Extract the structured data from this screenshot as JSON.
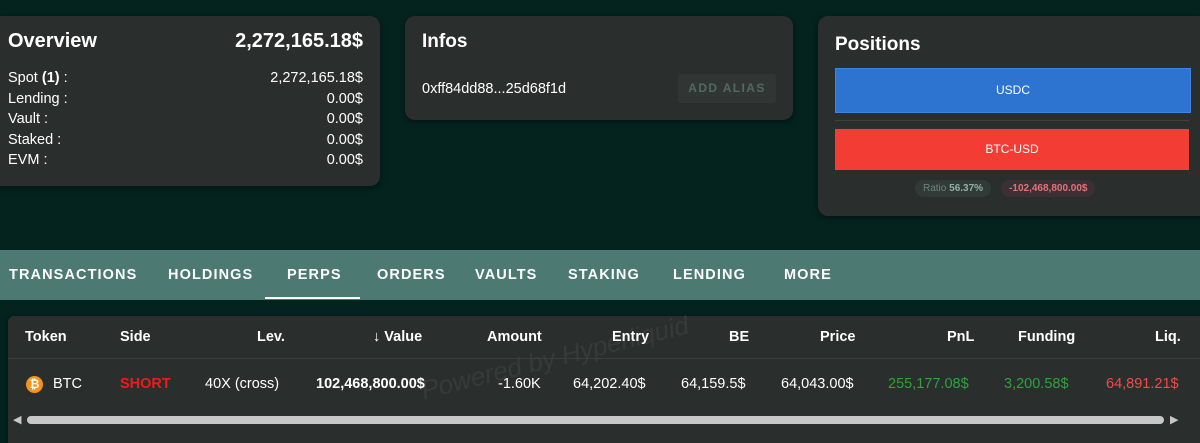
{
  "overview": {
    "title": "Overview",
    "total": "2,272,165.18$",
    "rows": [
      {
        "label": "Spot",
        "badge": "(1)",
        "suffix": " :",
        "value": "2,272,165.18$"
      },
      {
        "label": "Lending :",
        "value": "0.00$"
      },
      {
        "label": "Vault :",
        "value": "0.00$"
      },
      {
        "label": "Staked :",
        "value": "0.00$"
      },
      {
        "label": "EVM :",
        "value": "0.00$"
      }
    ]
  },
  "infos": {
    "title": "Infos",
    "address": "0xff84dd88...25d68f1d",
    "add_alias": "ADD ALIAS"
  },
  "positions": {
    "title": "Positions",
    "usdc_label": "USDC",
    "btc_label": "BTC-USD",
    "ratio_label": "Ratio",
    "ratio_value": "56.37%",
    "pnl_chip": "-102,468,800.00$"
  },
  "tabs": [
    "TRANSACTIONS",
    "HOLDINGS",
    "PERPS",
    "ORDERS",
    "VAULTS",
    "STAKING",
    "LENDING",
    "MORE"
  ],
  "active_tab": "PERPS",
  "table": {
    "headers": {
      "token": "Token",
      "side": "Side",
      "lev": "Lev.",
      "value_arrow": "↓",
      "value": "Value",
      "amount": "Amount",
      "entry": "Entry",
      "be": "BE",
      "price": "Price",
      "pnl": "PnL",
      "funding": "Funding",
      "liq": "Liq."
    },
    "rows": [
      {
        "token": "BTC",
        "coin_glyph": "₿",
        "side": "SHORT",
        "lev": "40X (cross)",
        "value": "102,468,800.00$",
        "amount": "-1.60K",
        "entry": "64,202.40$",
        "be": "64,159.5$",
        "price": "64,043.00$",
        "pnl": "255,177.08$",
        "funding": "3,200.58$",
        "liq": "64,891.21$"
      }
    ],
    "watermark": "Powered by Hyperliquid"
  },
  "scrollbar": {
    "left_arrow": "◀",
    "right_arrow": "▶"
  },
  "colors": {
    "background": "#04221e",
    "card": "#2a2e2d",
    "tabbar": "#4d7973",
    "usdc": "#2c74d0",
    "btc": "#f33d34",
    "positive": "#2ea33b",
    "negative": "#f44a48"
  }
}
